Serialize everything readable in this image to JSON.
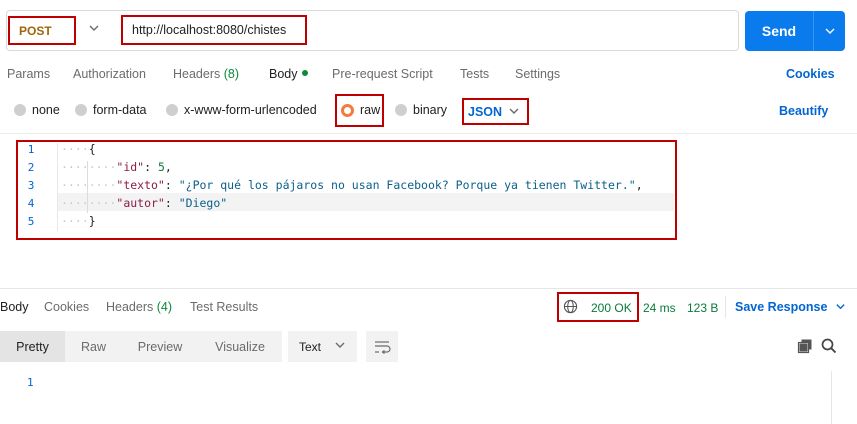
{
  "request": {
    "method": "POST",
    "url": "http://localhost:8080/chistes",
    "send_label": "Send"
  },
  "request_tabs": [
    {
      "label": "Params"
    },
    {
      "label": "Authorization"
    },
    {
      "label": "Headers",
      "count": "(8)"
    },
    {
      "label": "Body"
    },
    {
      "label": "Pre-request Script"
    },
    {
      "label": "Tests"
    },
    {
      "label": "Settings"
    }
  ],
  "cookies_label": "Cookies",
  "body_types": [
    {
      "label": "none"
    },
    {
      "label": "form-data"
    },
    {
      "label": "x-www-form-urlencoded"
    },
    {
      "label": "raw"
    },
    {
      "label": "binary"
    }
  ],
  "body_format": "JSON",
  "beautify_label": "Beautify",
  "editor": {
    "line_numbers": [
      "1",
      "2",
      "3",
      "4",
      "5"
    ],
    "lines": [
      {
        "indent": "····",
        "text": "{"
      },
      {
        "indent": "········",
        "key": "\"id\"",
        "sep": ": ",
        "value": "5",
        "end": ","
      },
      {
        "indent": "········",
        "key": "\"texto\"",
        "sep": ": ",
        "value": "\"¿Por qué los pájaros no usan Facebook? Porque ya tienen Twitter.\"",
        "end": ","
      },
      {
        "indent": "········",
        "key": "\"autor\"",
        "sep": ": ",
        "value": "\"Diego\"",
        "end": ""
      },
      {
        "indent": "····",
        "text": "}"
      }
    ]
  },
  "response": {
    "tabs": [
      {
        "label": "Body"
      },
      {
        "label": "Cookies"
      },
      {
        "label": "Headers",
        "count": "(4)"
      },
      {
        "label": "Test Results"
      }
    ],
    "status": "200 OK",
    "time": "24 ms",
    "size": "123 B",
    "save_label": "Save Response",
    "view_tabs": [
      "Pretty",
      "Raw",
      "Preview",
      "Visualize"
    ],
    "view_format": "Text",
    "body_line_numbers": [
      "1"
    ]
  }
}
